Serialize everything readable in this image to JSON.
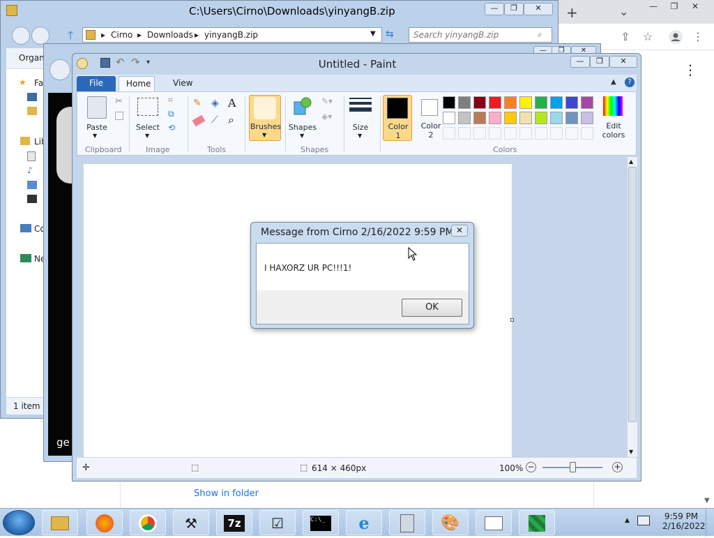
{
  "chrome": {
    "new_tab": "+",
    "minimize": "—",
    "maximize": "❐",
    "close": "✕",
    "tab_dropdown": "⌄",
    "share": "⇪",
    "bookmark": "☆",
    "menu": "⋮",
    "download_link": "Show in folder"
  },
  "explorer": {
    "title": "C:\\Users\\Cirno\\Downloads\\yinyangB.zip",
    "breadcrumbs": [
      "Cirno",
      "Downloads",
      "yinyangB.zip"
    ],
    "search_placeholder": "Search yinyangB.zip",
    "organize": "Organi",
    "nav_items": [
      "Fa",
      "Lib",
      "Co",
      "Ne"
    ],
    "status": "1 item",
    "minimize": "—",
    "maximize": "❐",
    "close": "✕"
  },
  "window2": {
    "text": "ge"
  },
  "paint": {
    "title": "Untitled - Paint",
    "tabs": {
      "file": "File",
      "home": "Home",
      "view": "View"
    },
    "buttons": {
      "paste": "Paste",
      "select": "Select",
      "brushes": "Brushes",
      "shapes": "Shapes",
      "size": "Size",
      "color1": "Color\n1",
      "color1_a": "Color",
      "color1_b": "1",
      "color2_a": "Color",
      "color2_b": "2",
      "edit_colors_a": "Edit",
      "edit_colors_b": "colors"
    },
    "groups": {
      "clipboard": "Clipboard",
      "image": "Image",
      "tools": "Tools",
      "shapes": "Shapes",
      "colors": "Colors"
    },
    "palette_row1": [
      "#000000",
      "#7f7f7f",
      "#880015",
      "#ed1c24",
      "#ff7f27",
      "#fff200",
      "#22b14c",
      "#00a2e8",
      "#3f48cc",
      "#a349a4"
    ],
    "palette_row2": [
      "#ffffff",
      "#c3c3c3",
      "#b97a57",
      "#ffaec9",
      "#ffc90e",
      "#efe4b0",
      "#b5e61d",
      "#99d9ea",
      "#7092be",
      "#c8bfe7"
    ],
    "status": {
      "canvas_size": "614 × 460px",
      "zoom": "100%"
    },
    "minimize": "—",
    "maximize": "❐",
    "close": "✕"
  },
  "message_box": {
    "title": "Message from Cirno 2/16/2022 9:59 PM",
    "text": "I HAXORZ UR PC!!!1!",
    "ok": "OK",
    "close": "✕"
  },
  "taskbar": {
    "time": "9:59 PM",
    "date": "2/16/2022",
    "items": [
      "explorer",
      "firefox",
      "chrome",
      "tool",
      "7z",
      "notepad",
      "cmd",
      "ie",
      "calculator",
      "paint",
      "window",
      "network"
    ],
    "labels": {
      "7z": "7z",
      "cmd": "C:\\_"
    }
  }
}
